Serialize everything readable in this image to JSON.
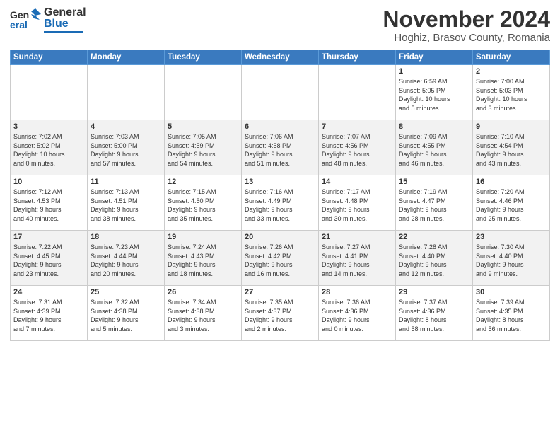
{
  "header": {
    "logo_line1": "General",
    "logo_line2": "Blue",
    "title": "November 2024",
    "subtitle": "Hoghiz, Brasov County, Romania"
  },
  "weekdays": [
    "Sunday",
    "Monday",
    "Tuesday",
    "Wednesday",
    "Thursday",
    "Friday",
    "Saturday"
  ],
  "weeks": [
    [
      {
        "day": "",
        "info": ""
      },
      {
        "day": "",
        "info": ""
      },
      {
        "day": "",
        "info": ""
      },
      {
        "day": "",
        "info": ""
      },
      {
        "day": "",
        "info": ""
      },
      {
        "day": "1",
        "info": "Sunrise: 6:59 AM\nSunset: 5:05 PM\nDaylight: 10 hours\nand 5 minutes."
      },
      {
        "day": "2",
        "info": "Sunrise: 7:00 AM\nSunset: 5:03 PM\nDaylight: 10 hours\nand 3 minutes."
      }
    ],
    [
      {
        "day": "3",
        "info": "Sunrise: 7:02 AM\nSunset: 5:02 PM\nDaylight: 10 hours\nand 0 minutes."
      },
      {
        "day": "4",
        "info": "Sunrise: 7:03 AM\nSunset: 5:00 PM\nDaylight: 9 hours\nand 57 minutes."
      },
      {
        "day": "5",
        "info": "Sunrise: 7:05 AM\nSunset: 4:59 PM\nDaylight: 9 hours\nand 54 minutes."
      },
      {
        "day": "6",
        "info": "Sunrise: 7:06 AM\nSunset: 4:58 PM\nDaylight: 9 hours\nand 51 minutes."
      },
      {
        "day": "7",
        "info": "Sunrise: 7:07 AM\nSunset: 4:56 PM\nDaylight: 9 hours\nand 48 minutes."
      },
      {
        "day": "8",
        "info": "Sunrise: 7:09 AM\nSunset: 4:55 PM\nDaylight: 9 hours\nand 46 minutes."
      },
      {
        "day": "9",
        "info": "Sunrise: 7:10 AM\nSunset: 4:54 PM\nDaylight: 9 hours\nand 43 minutes."
      }
    ],
    [
      {
        "day": "10",
        "info": "Sunrise: 7:12 AM\nSunset: 4:53 PM\nDaylight: 9 hours\nand 40 minutes."
      },
      {
        "day": "11",
        "info": "Sunrise: 7:13 AM\nSunset: 4:51 PM\nDaylight: 9 hours\nand 38 minutes."
      },
      {
        "day": "12",
        "info": "Sunrise: 7:15 AM\nSunset: 4:50 PM\nDaylight: 9 hours\nand 35 minutes."
      },
      {
        "day": "13",
        "info": "Sunrise: 7:16 AM\nSunset: 4:49 PM\nDaylight: 9 hours\nand 33 minutes."
      },
      {
        "day": "14",
        "info": "Sunrise: 7:17 AM\nSunset: 4:48 PM\nDaylight: 9 hours\nand 30 minutes."
      },
      {
        "day": "15",
        "info": "Sunrise: 7:19 AM\nSunset: 4:47 PM\nDaylight: 9 hours\nand 28 minutes."
      },
      {
        "day": "16",
        "info": "Sunrise: 7:20 AM\nSunset: 4:46 PM\nDaylight: 9 hours\nand 25 minutes."
      }
    ],
    [
      {
        "day": "17",
        "info": "Sunrise: 7:22 AM\nSunset: 4:45 PM\nDaylight: 9 hours\nand 23 minutes."
      },
      {
        "day": "18",
        "info": "Sunrise: 7:23 AM\nSunset: 4:44 PM\nDaylight: 9 hours\nand 20 minutes."
      },
      {
        "day": "19",
        "info": "Sunrise: 7:24 AM\nSunset: 4:43 PM\nDaylight: 9 hours\nand 18 minutes."
      },
      {
        "day": "20",
        "info": "Sunrise: 7:26 AM\nSunset: 4:42 PM\nDaylight: 9 hours\nand 16 minutes."
      },
      {
        "day": "21",
        "info": "Sunrise: 7:27 AM\nSunset: 4:41 PM\nDaylight: 9 hours\nand 14 minutes."
      },
      {
        "day": "22",
        "info": "Sunrise: 7:28 AM\nSunset: 4:40 PM\nDaylight: 9 hours\nand 12 minutes."
      },
      {
        "day": "23",
        "info": "Sunrise: 7:30 AM\nSunset: 4:40 PM\nDaylight: 9 hours\nand 9 minutes."
      }
    ],
    [
      {
        "day": "24",
        "info": "Sunrise: 7:31 AM\nSunset: 4:39 PM\nDaylight: 9 hours\nand 7 minutes."
      },
      {
        "day": "25",
        "info": "Sunrise: 7:32 AM\nSunset: 4:38 PM\nDaylight: 9 hours\nand 5 minutes."
      },
      {
        "day": "26",
        "info": "Sunrise: 7:34 AM\nSunset: 4:38 PM\nDaylight: 9 hours\nand 3 minutes."
      },
      {
        "day": "27",
        "info": "Sunrise: 7:35 AM\nSunset: 4:37 PM\nDaylight: 9 hours\nand 2 minutes."
      },
      {
        "day": "28",
        "info": "Sunrise: 7:36 AM\nSunset: 4:36 PM\nDaylight: 9 hours\nand 0 minutes."
      },
      {
        "day": "29",
        "info": "Sunrise: 7:37 AM\nSunset: 4:36 PM\nDaylight: 8 hours\nand 58 minutes."
      },
      {
        "day": "30",
        "info": "Sunrise: 7:39 AM\nSunset: 4:35 PM\nDaylight: 8 hours\nand 56 minutes."
      }
    ]
  ]
}
